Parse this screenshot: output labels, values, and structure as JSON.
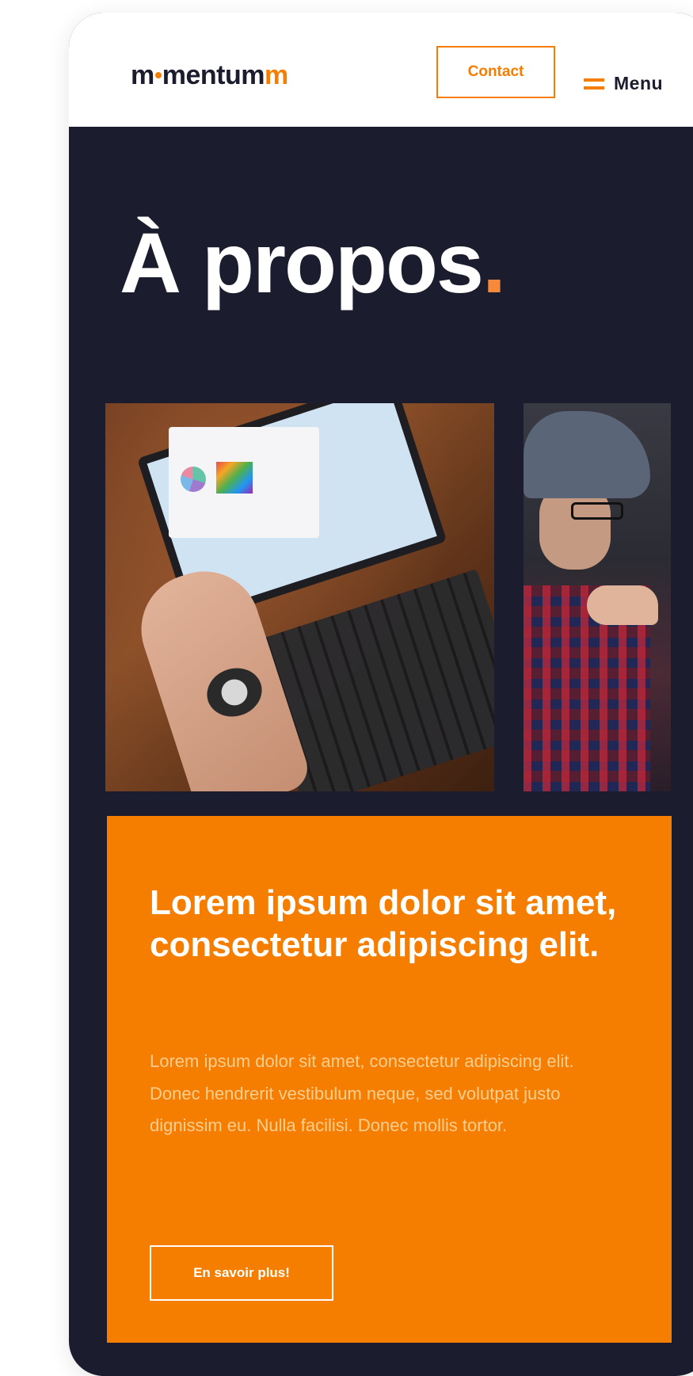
{
  "header": {
    "logo_part1": "m",
    "logo_part2": "mentum",
    "logo_part3": "m",
    "contact_label": "Contact",
    "menu_label": "Menu"
  },
  "hero": {
    "title": "À propos",
    "title_dot": "."
  },
  "card": {
    "heading": "Lorem ipsum dolor sit amet, consectetur adipiscing elit.",
    "body": "Lorem ipsum dolor sit amet, consectetur adipiscing elit. Donec hendrerit vestibulum neque, sed volutpat justo dignissim eu. Nulla facilisi. Donec mollis tortor.",
    "button_label": "En savoir plus!"
  },
  "colors": {
    "accent": "#f57e00",
    "dark": "#1b1c2e",
    "white": "#ffffff"
  },
  "icons": {
    "menu": "hamburger-menu-icon",
    "logo_dot": "circle-dot"
  }
}
